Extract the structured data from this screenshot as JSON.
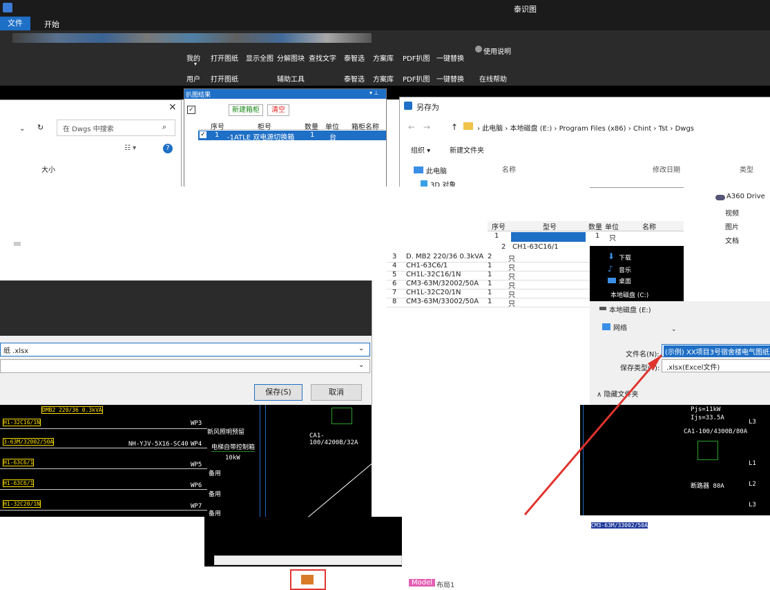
{
  "app": {
    "icon": "app-icon",
    "title": "泰识图"
  },
  "menu": {
    "file": "文件",
    "start": "开始"
  },
  "ribbon": {
    "buttons": [
      "我的",
      "打开图纸",
      "显示全图",
      "分解图块",
      "查找文字",
      "泰智选",
      "方案库",
      "PDF扒图",
      "一键替换",
      "使用说明"
    ],
    "groups": [
      "用户",
      "打开图纸",
      "辅助工具",
      "泰智选",
      "方案库",
      "PDF扒图",
      "一键替换",
      "在线帮助"
    ]
  },
  "extract_panel": {
    "title": "扒图结果",
    "pin": "▾ ⊥",
    "new_box": "新建箱柜",
    "clear": "清空",
    "headers": [
      "序号",
      "柜号",
      "数量",
      "单位",
      "箱柜名称"
    ],
    "row": {
      "index": "1",
      "cabinet": "-1ATLE 双电源切换箱",
      "qty": "1",
      "unit": "台",
      "name": ""
    }
  },
  "left_dialog": {
    "close": "×",
    "search_placeholder": "在 Dwgs 中搜索",
    "size_header": "大小",
    "filename_value": "纸 .xlsx",
    "save_button": "保存(S)",
    "cancel_button": "取消"
  },
  "saveas": {
    "title": "另存为",
    "breadcrumb": [
      "此电脑",
      "本地磁盘 (E:)",
      "Program Files (x86)",
      "Chint",
      "Tst",
      "Dwgs"
    ],
    "organize": "组织 ▾",
    "new_folder": "新建文件夹",
    "col_name": "名称",
    "col_date": "修改日期",
    "col_type": "类型",
    "nav": [
      "此电脑",
      "3D 对象",
      "A360 Drive",
      "视频",
      "图片",
      "文档",
      "下载",
      "音乐",
      "桌面",
      "本地磁盘 (C:)",
      "本地磁盘 (E:)",
      "网络"
    ],
    "filename_label": "文件名(N):",
    "filename_value": "(示例) XX项目3号宿舍楼电气图纸",
    "type_label": "保存类型(T):",
    "type_value": ".xlsx(Excel文件)",
    "hide_folders": "隐藏文件夹"
  },
  "sheet": {
    "headers": [
      "序号",
      "型号",
      "数量",
      "单位",
      "名称"
    ],
    "rows": [
      [
        "1",
        "",
        "1",
        "只",
        ""
      ],
      [
        "2",
        "CH1-63C16/1",
        "",
        "只",
        ""
      ],
      [
        "3",
        "D. MB2 220/36 0.3kVA",
        "2",
        "只",
        ""
      ],
      [
        "4",
        "CH1-63C6/1",
        "1",
        "只",
        ""
      ],
      [
        "5",
        "CH1L-32C16/1N",
        "1",
        "只",
        ""
      ],
      [
        "6",
        "CM3-63M/32002/50A",
        "1",
        "只",
        ""
      ],
      [
        "7",
        "CH1L-32C20/1N",
        "1",
        "只",
        ""
      ],
      [
        "8",
        "CM3-63M/33002/50A",
        "1",
        "只",
        ""
      ]
    ]
  },
  "cad_left": {
    "labels": [
      "DMB2 220/36 0.3kVA",
      "H1-32C16/1N",
      "3-63M/32002/50A",
      "H1-63C6/1",
      "H1-63C6/1",
      "H1-32C20/1N"
    ],
    "wp": [
      "WP3",
      "WP4",
      "WP5",
      "WP6",
      "WP7"
    ],
    "descs": [
      "新风照明预留",
      "电梯自带控制箱",
      "10kW",
      "备用",
      "备用",
      "备用"
    ],
    "cable": "NH-YJV-5X16-SC40",
    "relay": "CA1-100/4200B/32A"
  },
  "cad_right": {
    "pjs": "Pjs=11kW",
    "ijs": "Ijs=33.5A",
    "relay": "CA1-100/4300B/80A",
    "main": "断路器 80A",
    "bottom_label": "CM3-63M/33002/50A",
    "phases": [
      "L3",
      "L1",
      "L2",
      "L3"
    ]
  },
  "bottom": {
    "model_tab": "Model",
    "layout_tab": "布局1",
    "excel_icon": "excel-icon"
  }
}
